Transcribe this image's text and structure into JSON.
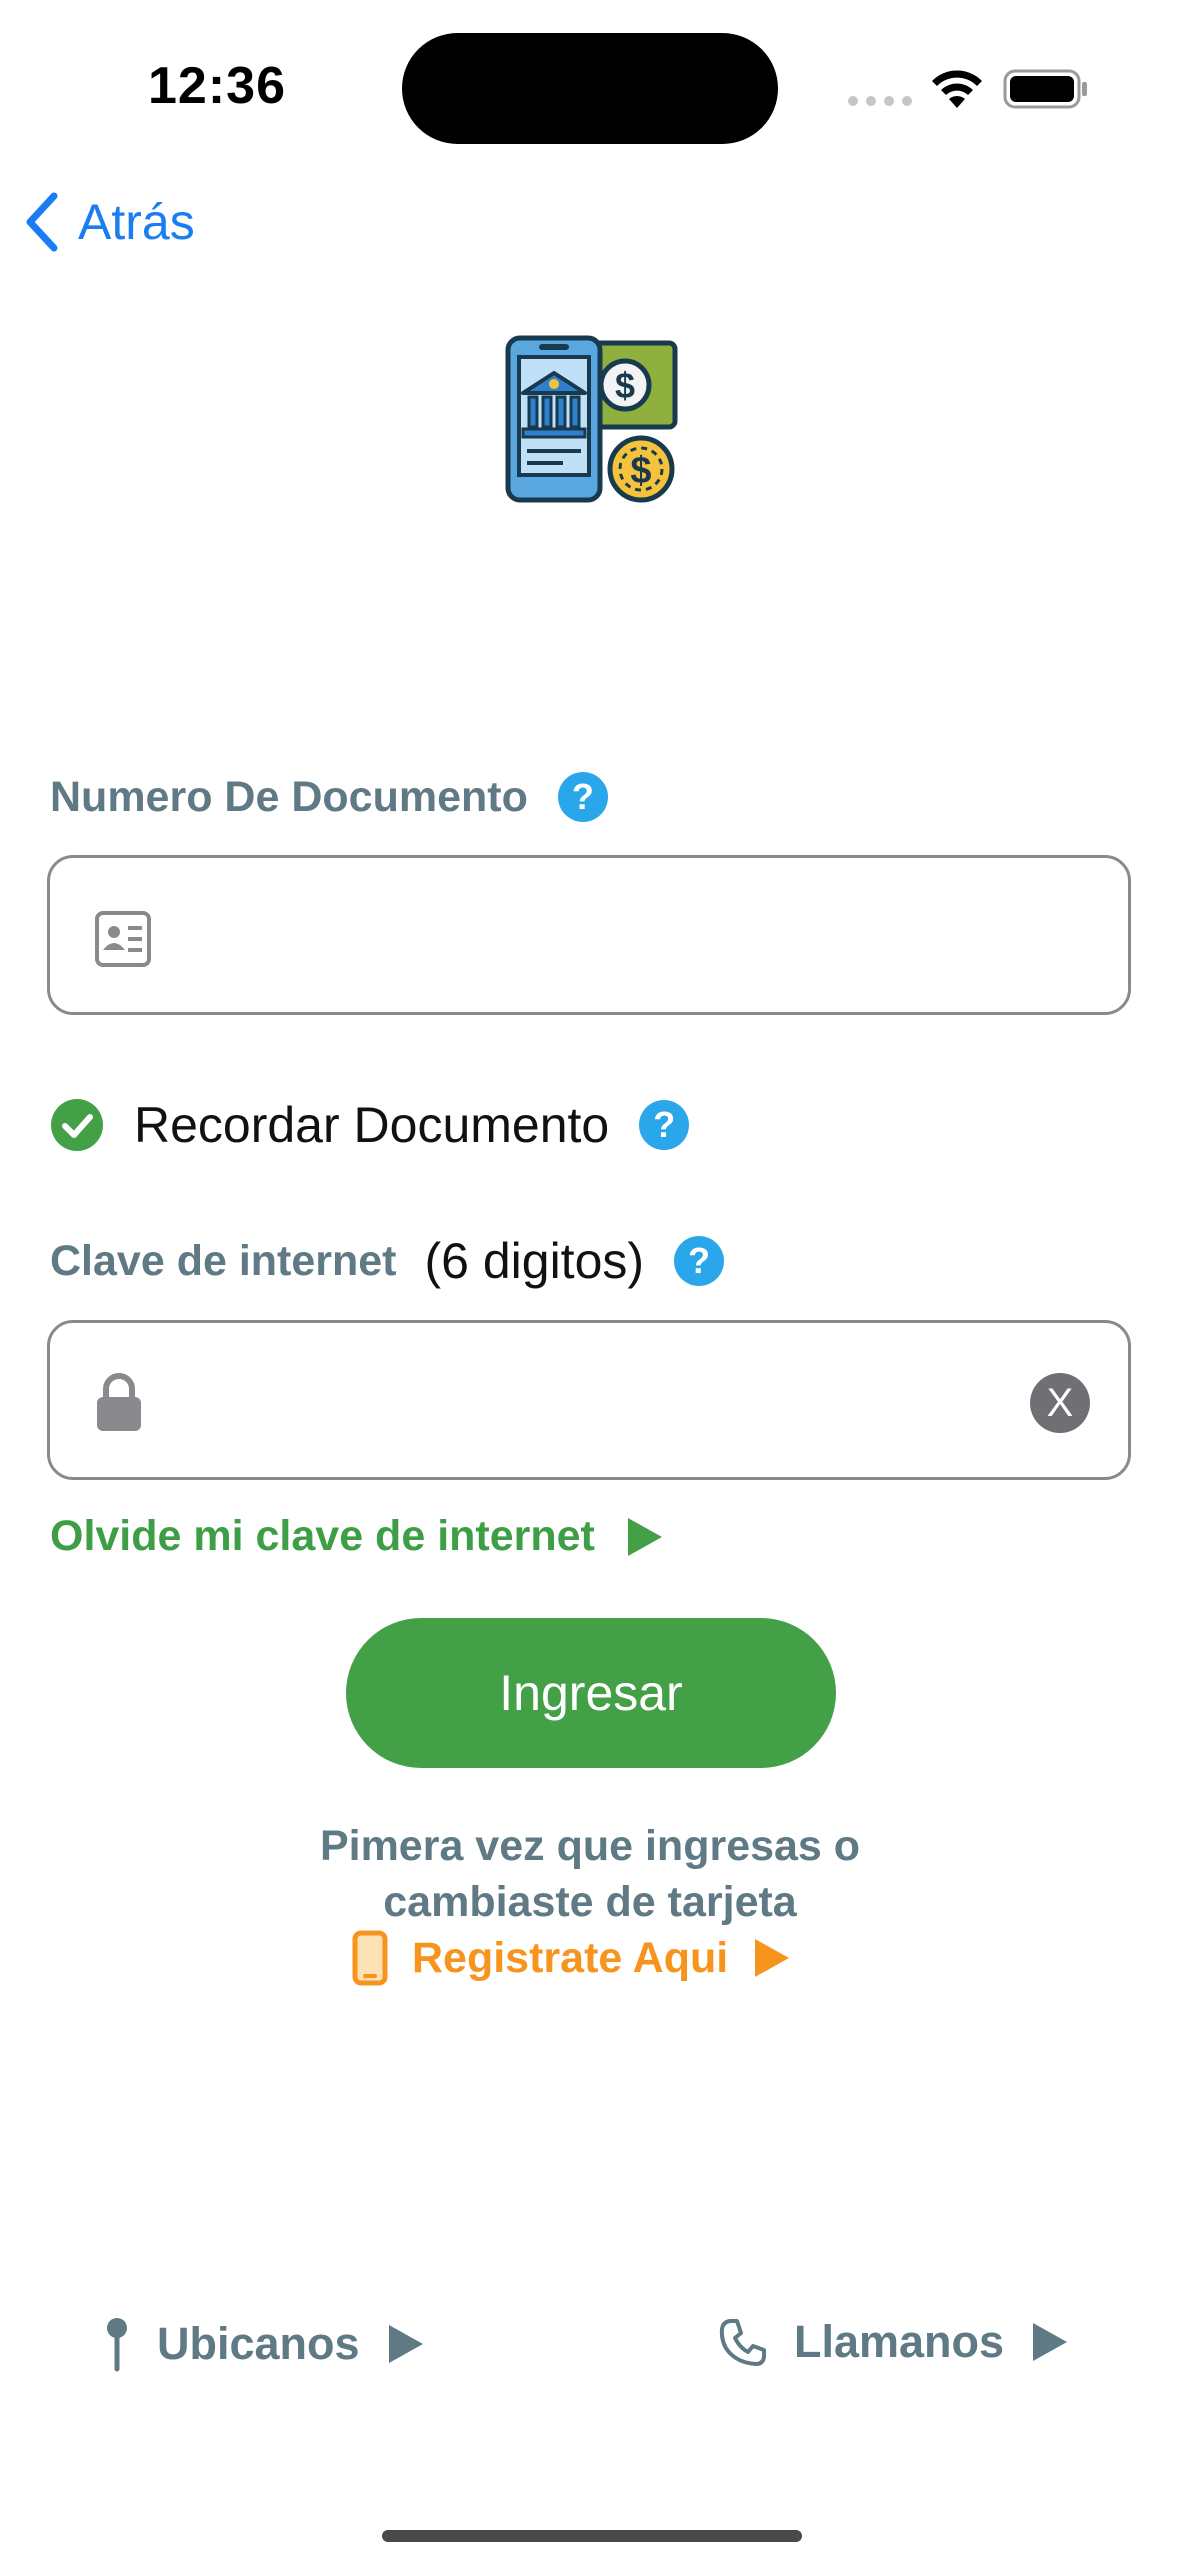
{
  "status_bar": {
    "time": "12:36"
  },
  "nav": {
    "back_label": "Atrás"
  },
  "document": {
    "label": "Numero De Documento",
    "help": "?",
    "value": "",
    "placeholder": ""
  },
  "remember": {
    "label": "Recordar Documento",
    "checked": true,
    "help": "?"
  },
  "password": {
    "label": "Clave de internet",
    "hint": "(6 digitos)",
    "help": "?",
    "value": "",
    "placeholder": "",
    "clear": "X"
  },
  "forgot": {
    "label": "Olvide mi clave de internet"
  },
  "login_button": {
    "label": "Ingresar"
  },
  "first_time": {
    "line1": "Pimera vez que ingresas o",
    "line2": "cambiaste de tarjeta",
    "register_label": "Registrate Aqui"
  },
  "footer": {
    "locate_label": "Ubicanos",
    "call_label": "Llamanos"
  },
  "colors": {
    "accent_blue": "#1a7df1",
    "label_gray": "#5f7985",
    "green": "#43a047",
    "orange": "#f7941d",
    "help_blue": "#2aa6ea"
  }
}
